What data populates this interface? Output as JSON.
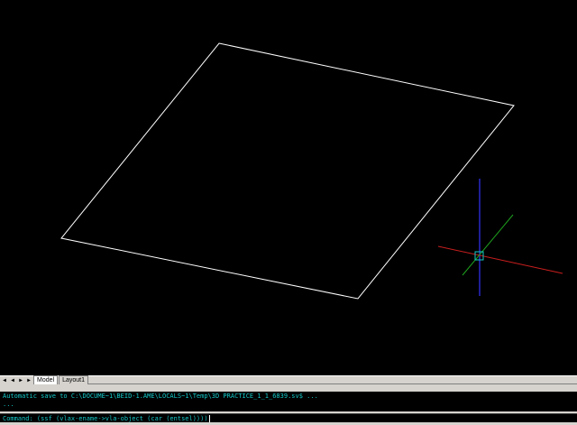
{
  "colors": {
    "background": "#000000",
    "geometry": "#ffffff",
    "command_text": "#14c8c8",
    "ucs_x_axis": "#c81e1e",
    "ucs_y_axis": "#1ea01e",
    "ucs_z_axis": "#1e1ec8",
    "ucs_box": "#14c8c8",
    "chrome": "#d6d3ce"
  },
  "drawing": {
    "object": "square-polyline",
    "view": "isometric"
  },
  "layout_tabs": {
    "nav_icons": [
      "first-tab-icon",
      "prev-tab-icon",
      "next-tab-icon",
      "last-tab-icon"
    ],
    "tabs": [
      {
        "label": "Model",
        "active": true
      },
      {
        "label": "Layout1",
        "active": false
      }
    ]
  },
  "command_line": {
    "history": [
      "Automatic save to C:\\DOCUME~1\\BEID-1.AME\\LOCALS~1\\Temp\\3D PRACTICE_1_1_6839.sv$ ...",
      "..."
    ],
    "input": "Command: (ssf (vlax-ename->vla-object (car (entsel))))"
  }
}
